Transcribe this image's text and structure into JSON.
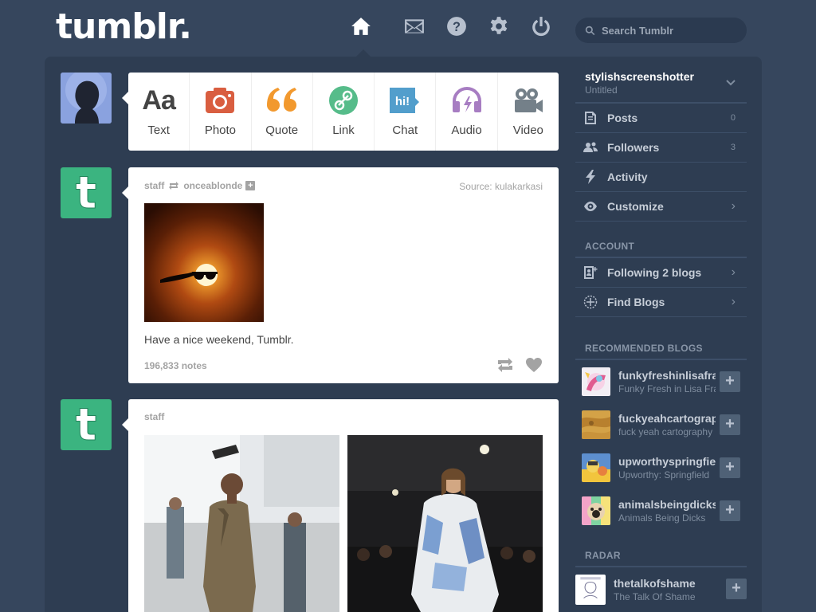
{
  "header": {
    "logo": "tumblr.",
    "search_placeholder": "Search Tumblr"
  },
  "post_types": [
    {
      "label": "Text",
      "icon": "text-icon"
    },
    {
      "label": "Photo",
      "icon": "photo-icon"
    },
    {
      "label": "Quote",
      "icon": "quote-icon"
    },
    {
      "label": "Link",
      "icon": "link-icon"
    },
    {
      "label": "Chat",
      "icon": "chat-icon"
    },
    {
      "label": "Audio",
      "icon": "audio-icon"
    },
    {
      "label": "Video",
      "icon": "video-icon"
    }
  ],
  "type_icons": {
    "text": "Aa",
    "chat": "hi!"
  },
  "posts": [
    {
      "author": "staff",
      "reblogged_from": "onceablonde",
      "source_label": "Source:",
      "source": "kulakarkasi",
      "caption": "Have a nice weekend, Tumblr.",
      "notes": "196,833 notes"
    },
    {
      "author": "staff"
    }
  ],
  "sidebar": {
    "blog_name": "stylishscreenshotter",
    "blog_title": "Untitled",
    "items": [
      {
        "label": "Posts",
        "count": "0"
      },
      {
        "label": "Followers",
        "count": "3"
      },
      {
        "label": "Activity"
      },
      {
        "label": "Customize"
      }
    ],
    "account_heading": "ACCOUNT",
    "account_items": [
      {
        "label": "Following 2 blogs"
      },
      {
        "label": "Find Blogs"
      }
    ],
    "recommended_heading": "RECOMMENDED BLOGS",
    "recommended": [
      {
        "name": "funkyfreshinlisafrank",
        "title": "Funky Fresh in Lisa Frank"
      },
      {
        "name": "fuckyeahcartography",
        "title": "fuck yeah cartography"
      },
      {
        "name": "upworthyspringfield",
        "title": "Upworthy: Springfield"
      },
      {
        "name": "animalsbeingdicks",
        "title": "Animals Being Dicks"
      }
    ],
    "radar_heading": "RADAR",
    "radar": {
      "name": "thetalkofshame",
      "title": "The Talk Of Shame"
    },
    "follow_symbol": "+"
  },
  "colors": {
    "background": "#36465d",
    "dashboard": "#2e3d52",
    "staff_avatar": "#3bb480",
    "text_icon": "#444444",
    "photo_icon": "#d95e40",
    "quote_icon": "#f2992e",
    "link_icon": "#56bc8a",
    "chat_icon": "#529ecc",
    "audio_icon": "#a77dc2",
    "video_icon": "#748089"
  }
}
